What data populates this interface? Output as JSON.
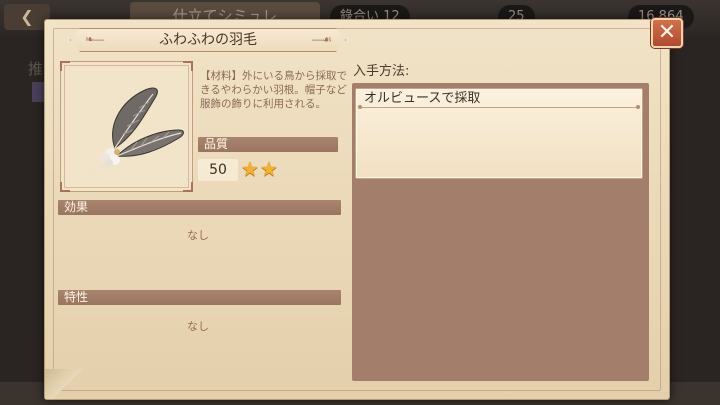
{
  "background": {
    "title": "仕立てシミュレ",
    "resource_1": "錄合い 12",
    "resource_2": "25",
    "resource_3": "16,864",
    "left_tab": "推"
  },
  "item": {
    "name": "ふわふわの羽毛",
    "description": "【材料】外にいる鳥から採取できるやわらかい羽根。帽子など服飾の飾りに利用される。",
    "quality_label": "品質",
    "quality_value": "50",
    "quality_stars": 2,
    "effect_label": "効果",
    "effect_value": "なし",
    "trait_label": "特性",
    "trait_value": "なし"
  },
  "acquisition": {
    "label": "入手方法:",
    "methods": [
      "オルビュースで採取"
    ]
  },
  "icons": {
    "close": "close-icon",
    "star": "star-icon",
    "item": "feather-icon"
  },
  "colors": {
    "star": "#f2b22c",
    "section_bar": "#a9856f",
    "close_button": "#c65a3a"
  }
}
